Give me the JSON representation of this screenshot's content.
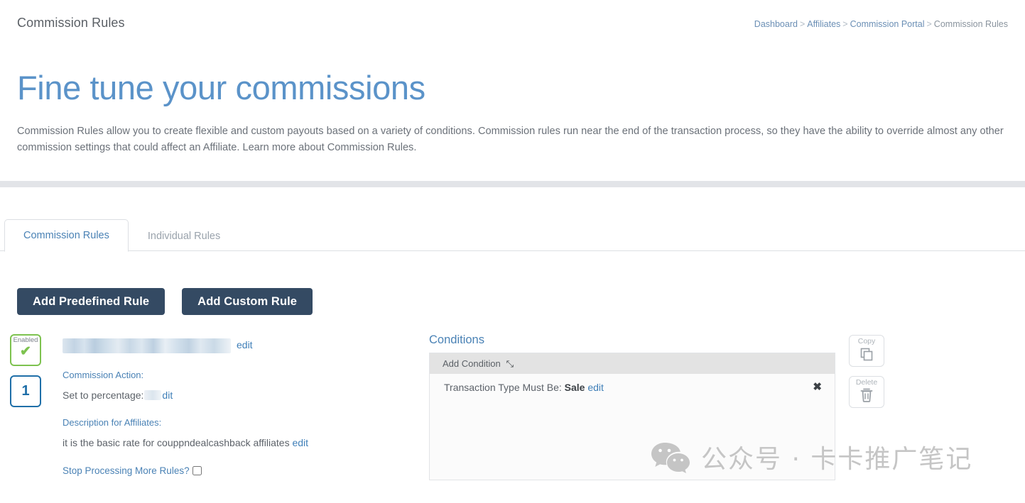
{
  "header": {
    "module_title": "Commission Rules",
    "breadcrumb": [
      {
        "label": "Dashboard",
        "link": true
      },
      {
        "label": "Affiliates",
        "link": true
      },
      {
        "label": "Commission Portal",
        "link": true
      },
      {
        "label": "Commission Rules",
        "link": false
      }
    ],
    "breadcrumb_separator": ">",
    "hero_title": "Fine tune your commissions",
    "hero_description": "Commission Rules allow you to create flexible and custom payouts based on a variety of conditions. Commission rules run near the end of the transaction process, so they have the ability to override almost any other commission settings that could affect an Affiliate. Learn more about Commission Rules."
  },
  "tabs": [
    {
      "label": "Commission Rules",
      "active": true
    },
    {
      "label": "Individual Rules",
      "active": false
    }
  ],
  "actions": {
    "add_predefined_rule": "Add Predefined Rule",
    "add_custom_rule": "Add Custom Rule"
  },
  "rule": {
    "enabled_label": "Enabled",
    "enabled_check": "✔",
    "order_number": "1",
    "title_redacted": true,
    "title_edit_label": "edit",
    "commission_action_label": "Commission Action:",
    "commission_action_prefix": "Set to percentage:",
    "commission_action_value_redacted": true,
    "commission_action_edit_label": "dit",
    "description_label": "Description for Affiliates:",
    "description_value": "it is the basic rate for couppndealcashback affiliates",
    "description_edit_label": "edit",
    "stop_processing_label": "Stop Processing More Rules?",
    "stop_processing_checked": false
  },
  "conditions": {
    "heading": "Conditions",
    "add_condition_label": "Add Condition",
    "expand_icon": "⤡",
    "items": [
      {
        "prefix": "Transaction Type Must Be:",
        "value": "Sale",
        "edit_label": "edit",
        "remove_icon": "✖"
      }
    ]
  },
  "rule_actions": {
    "copy_label": "Copy",
    "delete_label": "Delete"
  },
  "watermark": {
    "text": "公众号 · 卡卡推广笔记"
  },
  "colors": {
    "accent_blue": "#4a82b5",
    "hero_blue": "#5b93c9",
    "button_navy": "#344a63",
    "enabled_green": "#7dc24f",
    "order_blue": "#1f6fa8",
    "panel_bg": "#fbfbfb",
    "add_condition_bg": "#e3e3e3",
    "divider_gray": "#e2e4e8",
    "watermark_gray": "#c5c5c5"
  }
}
